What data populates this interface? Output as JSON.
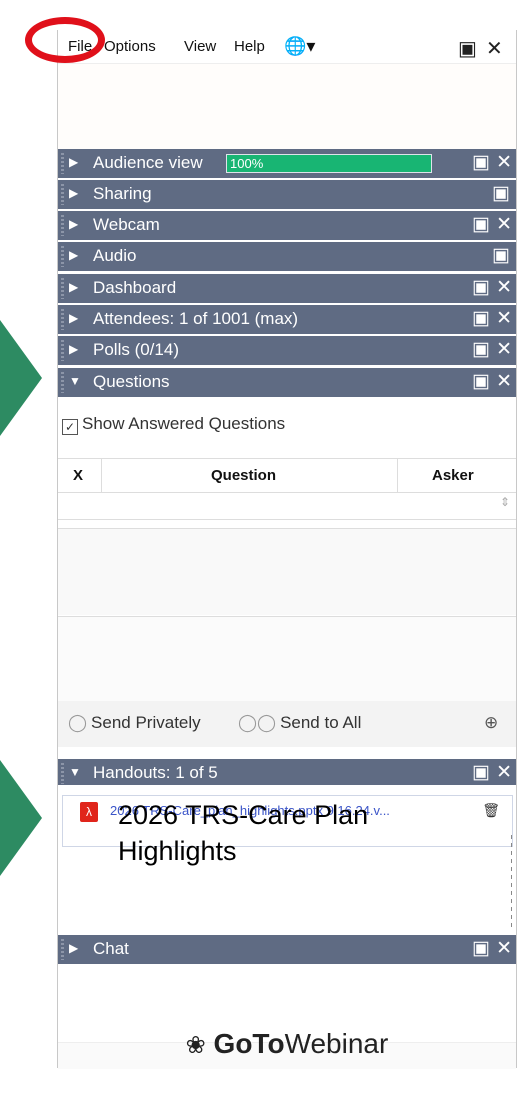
{
  "menu": {
    "file": "File",
    "options": "Options",
    "view": "View",
    "help": "Help"
  },
  "panels": {
    "audience_view": "Audience view",
    "audience_percent": "100%",
    "sharing": "Sharing",
    "webcam": "Webcam",
    "audio": "Audio",
    "dashboard": "Dashboard",
    "attendees": "Attendees:  1 of 1001 (max)",
    "polls": "Polls (0/14)",
    "questions": "Questions",
    "handouts": "Handouts: 1 of 5",
    "chat": "Chat"
  },
  "questions": {
    "show_answered": "Show Answered Questions",
    "col_x": "X",
    "col_question": "Question",
    "col_asker": "Asker",
    "send_privately": "Send Privately",
    "send_to_all": "Send to All"
  },
  "handouts": {
    "file_name": "2026 TRS-Care_plan_highlights.pptx 9.16.24.v...",
    "overlay_title": "2026 TRS-Care Plan Highlights"
  },
  "logo": {
    "part1": "GoTo",
    "part2": "Webinar"
  },
  "colors": {
    "bar_bg": "#5f6b83",
    "progress_fill": "#18b573",
    "arrow": "#2d8b62",
    "ring": "#e0101a",
    "pdf": "#e0251b"
  },
  "icons": {
    "globe": "globe-icon",
    "pop_out": "pop-out-icon",
    "close": "close-icon",
    "expand": "triangle-right-icon",
    "collapse": "triangle-down-icon",
    "trash": "trash-icon",
    "pdf": "pdf-icon",
    "person": "person-icon",
    "people": "people-icon",
    "dropdown": "chevron-circle-down-icon",
    "logo": "gotowebinar-logo-icon"
  }
}
